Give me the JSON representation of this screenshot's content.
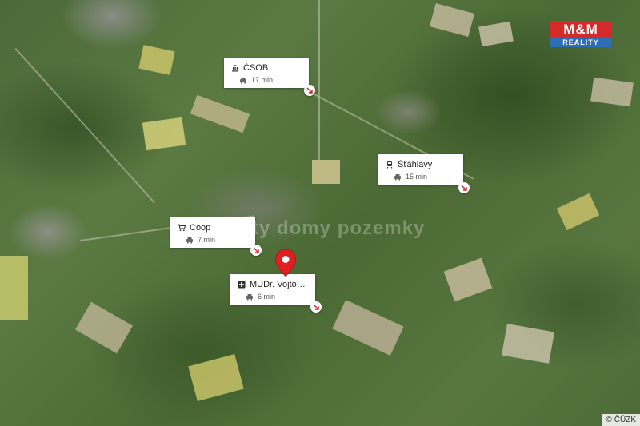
{
  "map": {
    "watermark": "byty domy pozemky",
    "copyright": "© ČÚZK",
    "logo": {
      "top": "M&M",
      "bottom": "REALITY"
    },
    "colors": {
      "label_bg": "#ffffff",
      "pin": "#e02020",
      "logo_red": "#d42a2a",
      "logo_blue": "#2e6eb5"
    }
  },
  "places": [
    {
      "name": "ČSOB",
      "icon": "bank-icon",
      "time": "17 min",
      "mode": "car-icon"
    },
    {
      "name": "Šťáhlavy",
      "icon": "train-icon",
      "time": "15 min",
      "mode": "car-icon"
    },
    {
      "name": "Coop",
      "icon": "cart-icon",
      "time": "7 min",
      "mode": "car-icon"
    },
    {
      "name": "MUDr. Vojtová M...",
      "icon": "medical-cross-icon",
      "time": "6 min",
      "mode": "car-icon"
    }
  ]
}
